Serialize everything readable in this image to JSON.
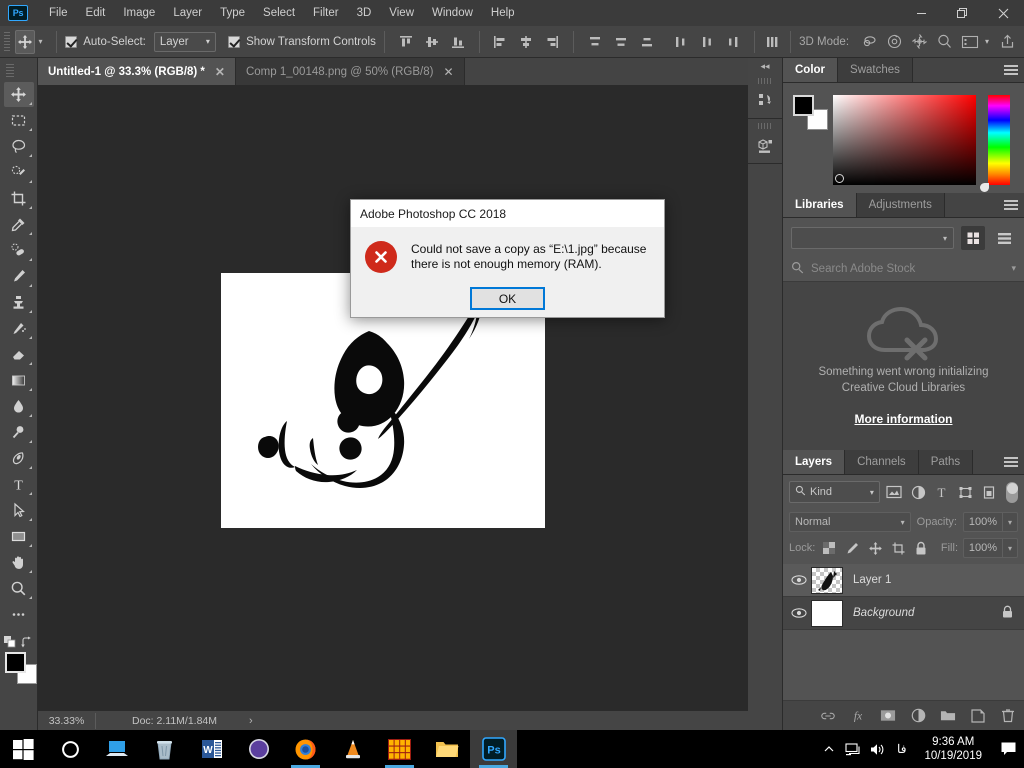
{
  "app": {
    "logo": "Ps",
    "menus": [
      "File",
      "Edit",
      "Image",
      "Layer",
      "Type",
      "Select",
      "Filter",
      "3D",
      "View",
      "Window",
      "Help"
    ],
    "window_controls": [
      "minimize-button",
      "restore-button",
      "close-button"
    ]
  },
  "options_bar": {
    "tool_icon": "move-tool-icon",
    "auto_select_label": "Auto-Select:",
    "auto_select_checked": true,
    "auto_select_value": "Layer",
    "show_transform_label": "Show Transform Controls",
    "show_transform_checked": true,
    "align_icons": [
      "align-top-edges-icon",
      "align-vertical-centers-icon",
      "align-bottom-edges-icon",
      "align-left-edges-icon",
      "align-horizontal-centers-icon",
      "align-right-edges-icon"
    ],
    "distribute_icons": [
      "distribute-top-edges-icon",
      "distribute-vertical-centers-icon",
      "distribute-bottom-edges-icon",
      "distribute-left-edges-icon",
      "distribute-horizontal-centers-icon",
      "distribute-right-edges-icon"
    ],
    "extra_icon": "distribute-spacing-icon",
    "d3_mode_label": "3D Mode:",
    "d3_icons": [
      "orbit-3d-icon",
      "roll-3d-icon",
      "pan-3d-icon",
      "zoom-3d-icon"
    ],
    "workspace_icon": "workspace-switcher-icon",
    "share_icon": "share-icon"
  },
  "tabs": [
    {
      "label": "Untitled-1 @ 33.3% (RGB/8) *",
      "active": true
    },
    {
      "label": "Comp 1_00148.png @ 50% (RGB/8)",
      "active": false
    }
  ],
  "toolbar": {
    "tools": [
      {
        "name": "move-tool",
        "active": true
      },
      {
        "name": "rectangular-marquee-tool",
        "active": false
      },
      {
        "name": "lasso-tool",
        "active": false
      },
      {
        "name": "quick-selection-tool",
        "active": false
      },
      {
        "name": "crop-tool",
        "active": false
      },
      {
        "name": "eyedropper-tool",
        "active": false
      },
      {
        "name": "healing-brush-tool",
        "active": false
      },
      {
        "name": "brush-tool",
        "active": false
      },
      {
        "name": "clone-stamp-tool",
        "active": false
      },
      {
        "name": "history-brush-tool",
        "active": false
      },
      {
        "name": "eraser-tool",
        "active": false
      },
      {
        "name": "gradient-tool",
        "active": false
      },
      {
        "name": "blur-tool",
        "active": false
      },
      {
        "name": "dodge-tool",
        "active": false
      },
      {
        "name": "pen-tool",
        "active": false
      },
      {
        "name": "type-tool",
        "active": false
      },
      {
        "name": "path-selection-tool",
        "active": false
      },
      {
        "name": "rectangle-tool",
        "active": false
      },
      {
        "name": "hand-tool",
        "active": false
      },
      {
        "name": "zoom-tool",
        "active": false
      },
      {
        "name": "edit-toolbar-tool",
        "active": false
      }
    ],
    "foreground_color": "#000000",
    "background_color": "#ffffff"
  },
  "status_bar": {
    "zoom": "33.33%",
    "doc": "Doc: 2.11M/1.84M",
    "arrow": "›"
  },
  "dock_icons": {
    "collapse": "◂◂",
    "items": [
      "history-panel-icon",
      "3d-panel-icon"
    ]
  },
  "color_panel": {
    "tabs": [
      {
        "label": "Color",
        "active": true
      },
      {
        "label": "Swatches",
        "active": false
      }
    ],
    "foreground": "#000000",
    "background": "#ffffff",
    "ramp_base": "#ff0000"
  },
  "libraries_panel": {
    "tabs": [
      {
        "label": "Libraries",
        "active": true
      },
      {
        "label": "Adjustments",
        "active": false
      }
    ],
    "library_select_value": "",
    "search_placeholder": "Search Adobe Stock",
    "view_grid_active": true,
    "error_line1": "Something went wrong initializing",
    "error_line2": "Creative Cloud Libraries",
    "more_information": "More information",
    "empty_icon": "cloud-error-icon"
  },
  "layers_panel": {
    "tabs": [
      {
        "label": "Layers",
        "active": true
      },
      {
        "label": "Channels",
        "active": false
      },
      {
        "label": "Paths",
        "active": false
      }
    ],
    "filter_kind": "Kind",
    "filter_icons": [
      "filter-pixel-icon",
      "filter-adjustment-icon",
      "filter-type-icon",
      "filter-shape-icon",
      "filter-smart-object-icon"
    ],
    "blend_mode": "Normal",
    "opacity_label": "Opacity:",
    "opacity_value": "100%",
    "lock_label": "Lock:",
    "lock_icons": [
      "lock-transparent-pixels-icon",
      "lock-image-pixels-icon",
      "lock-position-icon",
      "lock-artboard-icon",
      "lock-all-icon"
    ],
    "fill_label": "Fill:",
    "fill_value": "100%",
    "layers": [
      {
        "name": "Layer 1",
        "visible": true,
        "selected": true,
        "locked": false,
        "italic": false,
        "thumb": "transparent"
      },
      {
        "name": "Background",
        "visible": true,
        "selected": false,
        "locked": true,
        "italic": true,
        "thumb": "white"
      }
    ],
    "footer_icons": [
      "link-layers-icon",
      "layer-style-icon",
      "add-mask-icon",
      "adjustment-layer-icon",
      "new-group-icon",
      "new-layer-icon",
      "delete-layer-icon"
    ]
  },
  "dialog": {
    "title": "Adobe Photoshop CC 2018",
    "message_line1": "Could not save a copy as “E:\\1.jpg” because",
    "message_line2": "there is not enough memory (RAM).",
    "ok_label": "OK",
    "icon": "error-icon",
    "icon_color": "#cf2a1b",
    "focus_color": "#0078d7"
  },
  "taskbar": {
    "items": [
      {
        "name": "start-button",
        "icon": "windows-logo-icon",
        "active": false,
        "running": false
      },
      {
        "name": "cortana-search",
        "icon": "cortana-circle-icon",
        "active": false,
        "running": false
      },
      {
        "name": "task-view",
        "icon": "task-view-icon",
        "active": false,
        "running": false
      },
      {
        "name": "recycle-bin",
        "icon": "recycle-bin-icon",
        "active": false,
        "running": false
      },
      {
        "name": "microsoft-word",
        "icon": "word-icon",
        "active": false,
        "running": false
      },
      {
        "name": "media-app",
        "icon": "purple-orb-icon",
        "active": false,
        "running": false
      },
      {
        "name": "firefox",
        "icon": "firefox-icon",
        "active": false,
        "running": true
      },
      {
        "name": "vlc-player",
        "icon": "vlc-cone-icon",
        "active": false,
        "running": false
      },
      {
        "name": "grid-app",
        "icon": "orange-grid-icon",
        "active": false,
        "running": true
      },
      {
        "name": "file-explorer",
        "icon": "folder-icon",
        "active": false,
        "running": false
      },
      {
        "name": "photoshop",
        "icon": "photoshop-icon",
        "active": true,
        "running": true
      }
    ],
    "tray": {
      "chevron": "show-hidden-icons",
      "network": "network-icon",
      "volume": "volume-icon",
      "language": "فا",
      "time": "9:36 AM",
      "date": "10/19/2019",
      "action_center": "action-center-icon"
    }
  },
  "canvas": {
    "artwork_alt": "persian-calligraphy-goftar-ma",
    "background": "#ffffff"
  }
}
